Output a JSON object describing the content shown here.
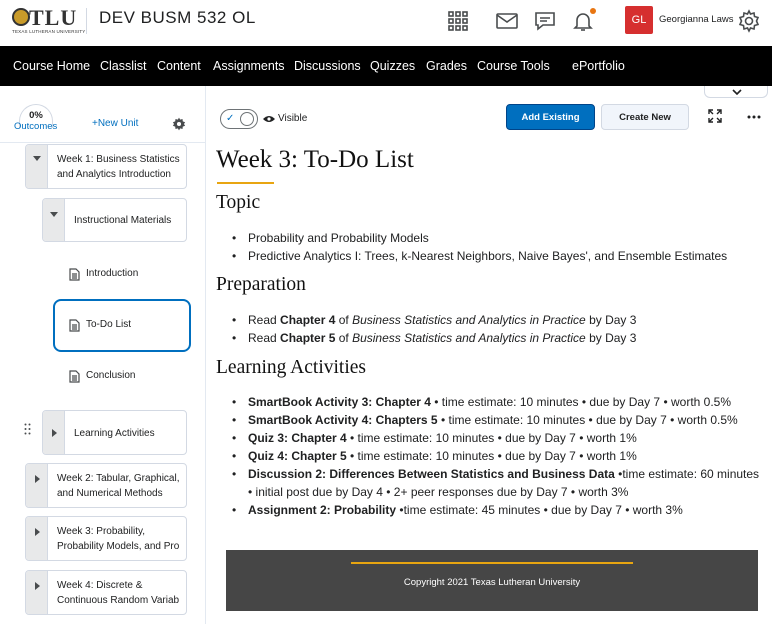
{
  "header": {
    "logo_text": "TLU",
    "logo_sub": "TEXAS LUTHERAN UNIVERSITY",
    "course_title": "DEV BUSM 532 OL",
    "user_initials": "GL",
    "user_name": "Georgianna Laws",
    "icons": [
      "apps-grid-icon",
      "mail-icon",
      "chat-icon",
      "bell-icon",
      "gear-icon"
    ]
  },
  "nav": {
    "items": [
      "Course Home",
      "Classlist",
      "Content",
      "Assignments",
      "Discussions",
      "Quizzes",
      "Grades",
      "Course Tools",
      "ePortfolio"
    ]
  },
  "sidebar": {
    "outcomes_pct": "0%",
    "outcomes_label": "Outcomes",
    "new_unit": "+New Unit",
    "tree": [
      {
        "line1": "Week 1: Business Statistics",
        "line2": "and Analytics Introduction",
        "expanded": true
      },
      {
        "line1": "Instructional Materials",
        "expanded": true
      },
      {
        "topic": "Introduction"
      },
      {
        "topic": "To-Do List",
        "selected": true
      },
      {
        "topic": "Conclusion"
      },
      {
        "line1": "Learning Activities",
        "expanded": false
      },
      {
        "line1": "Week 2: Tabular, Graphical,",
        "line2": "and Numerical Methods",
        "expanded": false
      },
      {
        "line1": "Week 3: Probability,",
        "line2": "Probability Models, and Pro",
        "expanded": false
      },
      {
        "line1": "Week 4: Discrete &",
        "line2": "Continuous Random Variab",
        "expanded": false
      }
    ]
  },
  "toolbar": {
    "visible_label": "Visible",
    "add_existing": "Add Existing",
    "create_new": "Create New"
  },
  "content": {
    "title": "Week 3: To-Do List",
    "topic_heading": "Topic",
    "topics": [
      "Probability and Probability Models",
      "Predictive Analytics I: Trees, k-Nearest Neighbors, Naive Bayes', and Ensemble Estimates"
    ],
    "prep_heading": "Preparation",
    "prep": [
      {
        "pre": "Read ",
        "bold": "Chapter 4",
        "mid": " of ",
        "ital": "Business Statistics and Analytics in Practice",
        "post": " by Day 3"
      },
      {
        "pre": "Read ",
        "bold": "Chapter 5",
        "mid": " of ",
        "ital": "Business Statistics and Analytics in Practice",
        "post": " by Day 3"
      }
    ],
    "activities_heading": "Learning Activities",
    "activities": [
      {
        "bold": "SmartBook Activity 3: Chapter 4",
        "rest": " • time estimate: 10 minutes • due by Day 7 • worth 0.5%"
      },
      {
        "bold": "SmartBook Activity 4: Chapters 5",
        "rest": " • time estimate: 10 minutes • due by Day 7 • worth 0.5%"
      },
      {
        "bold": "Quiz 3: Chapter 4",
        "rest": " • time estimate: 10 minutes • due by Day 7 • worth 1%"
      },
      {
        "bold": "Quiz 4: Chapter 5",
        "rest": " • time estimate: 10 minutes • due by Day 7 • worth 1%"
      },
      {
        "bold": "Discussion 2: Differences Between Statistics and Business Data",
        "rest": " •time estimate: 60 minutes",
        "line2": "• initial post due by Day 4 • 2+ peer responses due by Day 7 • worth 3%"
      },
      {
        "bold": "Assignment 2: Probability",
        "rest": " •time estimate: 45 minutes • due by Day 7 • worth 3%"
      }
    ],
    "footer": "Copyright 2021 Texas Lutheran University"
  },
  "colors": {
    "accent_blue": "#006fbf",
    "gold": "#e8a511",
    "nav_bg": "#000000",
    "avatar_red": "#d62f2f",
    "footer_bg": "#464646"
  }
}
